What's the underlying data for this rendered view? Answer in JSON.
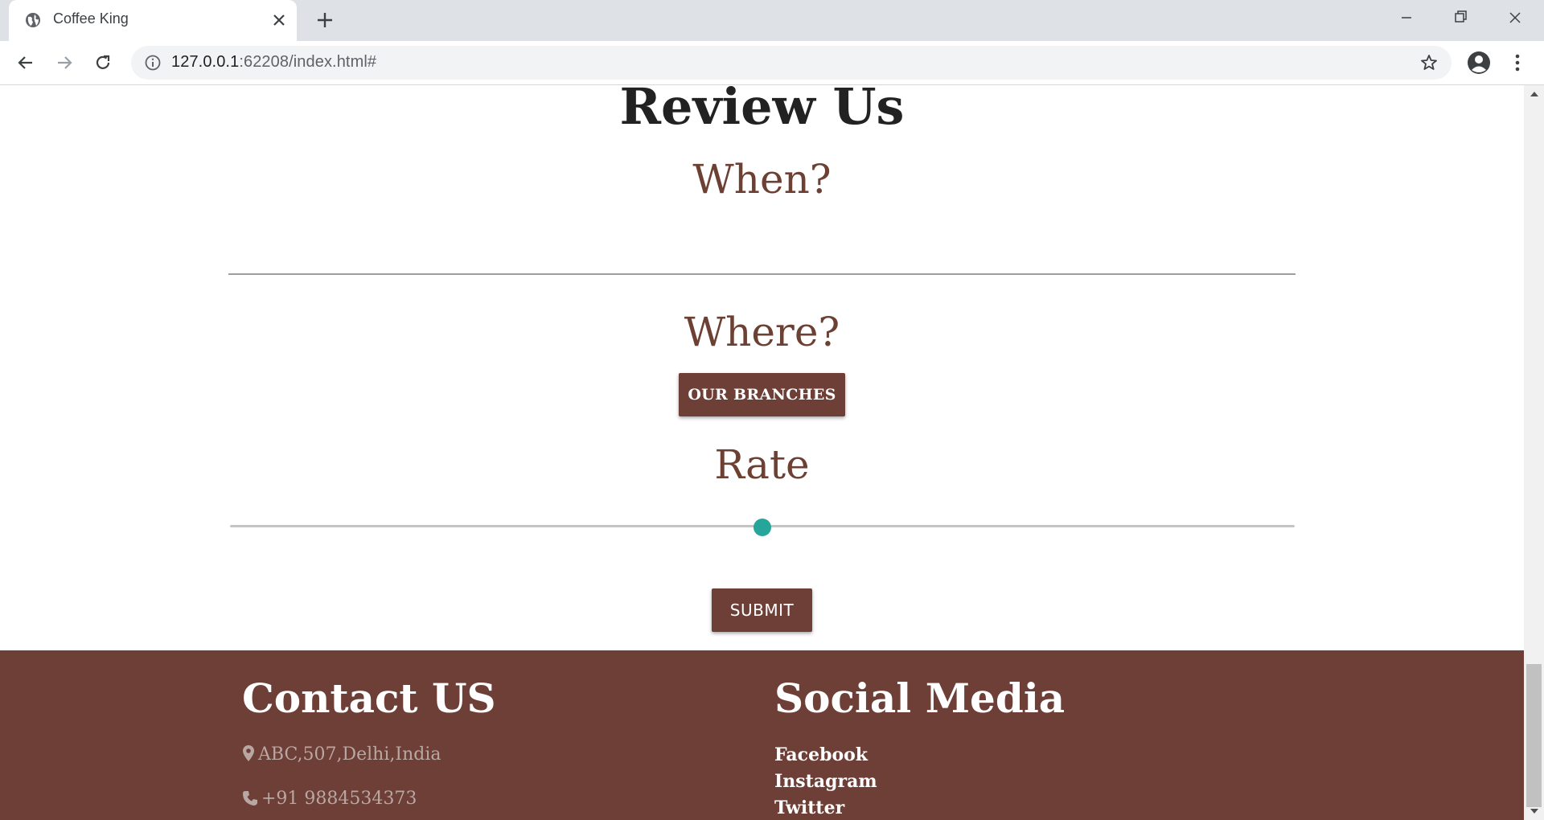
{
  "browser": {
    "tab_title": "Coffee King",
    "url_host": "127.0.0.1",
    "url_rest": ":62208/index.html#",
    "icons": {
      "favicon": "globe-icon",
      "close": "close-icon",
      "new_tab": "plus-icon",
      "back": "arrow-back-icon",
      "forward": "arrow-forward-icon",
      "reload": "reload-icon",
      "info": "info-icon",
      "bookmark": "star-icon",
      "profile": "profile-icon",
      "menu": "kebab-menu-icon"
    }
  },
  "review": {
    "title": "Review Us",
    "when_label": "When?",
    "where_label": "Where?",
    "branches_button": "OUR BRANCHES",
    "rate_label": "Rate",
    "rate_value_fraction": 0.5,
    "submit_button": "SUBMIT"
  },
  "footer": {
    "contact_title": "Contact US",
    "address": "ABC,507,Delhi,India",
    "phone": "+91 9884534373",
    "social_title": "Social Media",
    "social_links": [
      "Facebook",
      "Instagram",
      "Twitter"
    ]
  },
  "colors": {
    "brand_brown": "#6d3f36",
    "heading_brown": "#6d4034",
    "slider_accent": "#26a69a"
  }
}
